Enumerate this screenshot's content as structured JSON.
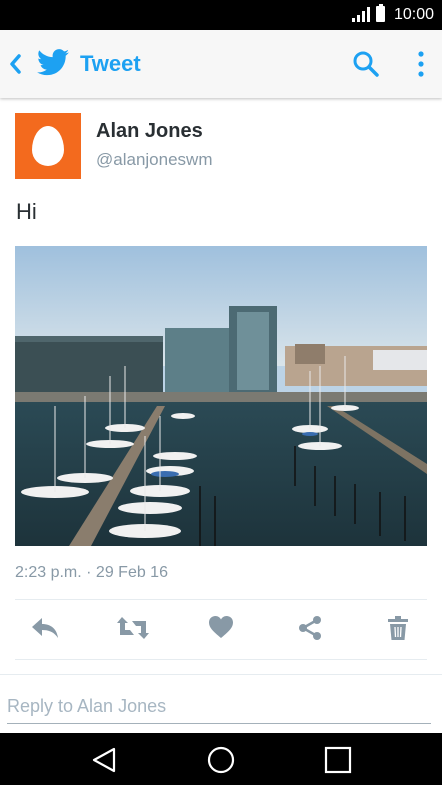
{
  "status_bar": {
    "time": "10:00"
  },
  "app_bar": {
    "title": "Tweet"
  },
  "tweet": {
    "author_name": "Alan Jones",
    "author_handle": "@alanjoneswm",
    "text": "Hi",
    "timestamp": "2:23 p.m. · 29 Feb 16"
  },
  "reply": {
    "placeholder": "Reply to Alan Jones",
    "value": ""
  },
  "colors": {
    "brand": "#1da1f2",
    "action_icon": "#8899a6",
    "avatar": "#f36a1e"
  },
  "icons": {
    "back": "chevron-left-icon",
    "logo": "twitter-bird-icon",
    "search": "search-icon",
    "overflow": "more-vert-icon",
    "reply": "reply-icon",
    "retweet": "retweet-icon",
    "like": "heart-icon",
    "share": "share-icon",
    "delete": "trash-icon"
  }
}
